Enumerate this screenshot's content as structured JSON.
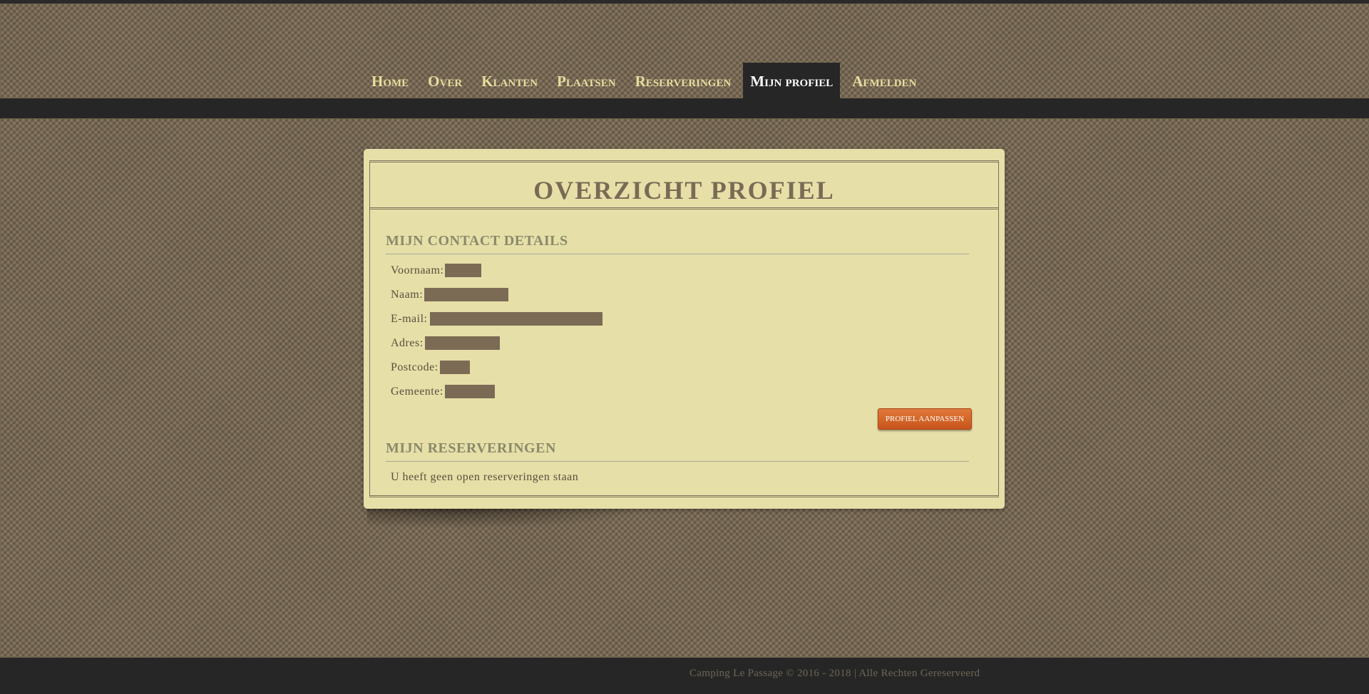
{
  "nav": {
    "items": [
      "Home",
      "Over",
      "Klanten",
      "Plaatsen",
      "Reserveringen",
      "Mijn profiel",
      "Afmelden"
    ],
    "active": "Mijn profiel"
  },
  "card": {
    "title": "OVERZICHT PROFIEL",
    "contact_heading": "MIJN CONTACT DETAILS",
    "fields": {
      "first_name_label": "Voornaam:",
      "last_name_label": "Naam:",
      "email_label": "E-mail:",
      "address_label": "Adres:",
      "postcode_label": "Postcode:",
      "city_label": "Gemeente:"
    },
    "edit_button": "PROFIEL AANPASSEN",
    "reservations_heading": "MIJN RESERVERINGEN",
    "reservations_empty": "U heeft geen open reserveringen staan"
  },
  "footer": {
    "text": "Camping Le Passage © 2016 - 2018 | Alle Rechten Gereserveerd"
  },
  "colors": {
    "card_bg": "#e6dfa8",
    "nav_text": "#e8dd9e",
    "dark_bar": "#262626",
    "button": "#d0652a",
    "redaction": "#7b6b55"
  }
}
